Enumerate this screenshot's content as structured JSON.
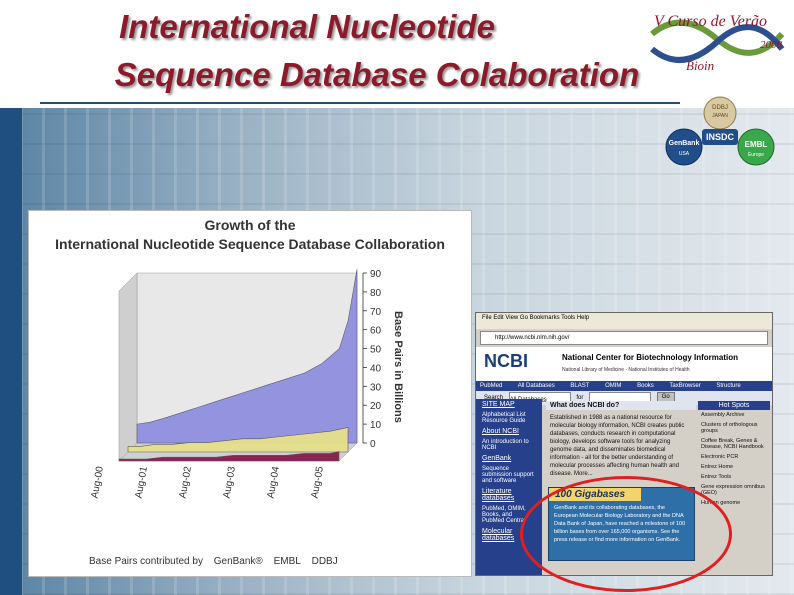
{
  "title": {
    "line1": "International Nucleotide",
    "line2": "Sequence Database Colaboration"
  },
  "logo_curso": {
    "text1": "V Curso de Verão",
    "text2": "2008",
    "text3": "Bioin"
  },
  "logo_insdc": {
    "ddbj": "DDBJ",
    "ddbj_sub": "JAPAN",
    "center": "INSDC",
    "genbank": "GenBank",
    "genbank_sub": "USA",
    "embl": "EMBL",
    "embl_sub": "Europe"
  },
  "chart_panel": {
    "title1": "Growth of the",
    "title2": "International Nucleotide Sequence Database Collaboration",
    "legend_prefix": "Base Pairs contributed by",
    "legend_items": [
      {
        "label": "GenBank®",
        "color": "#8f8fe0"
      },
      {
        "label": "EMBL",
        "color": "#e6e08a"
      },
      {
        "label": "DDBJ",
        "color": "#8a1a4a"
      }
    ]
  },
  "chart_data": {
    "type": "area",
    "title": "Growth of the International Nucleotide Sequence Database Collaboration",
    "ylabel": "Base Pairs in Billions",
    "xlabel": "",
    "x_tick_labels": [
      "Aug-00",
      "Aug-01",
      "Aug-02",
      "Aug-03",
      "Aug-04",
      "Aug-05"
    ],
    "y_ticks": [
      0,
      10,
      20,
      30,
      40,
      50,
      60,
      70,
      80,
      90
    ],
    "ylim": [
      0,
      90
    ],
    "x": [
      2000.6,
      2000.9,
      2001.2,
      2001.6,
      2002.0,
      2002.4,
      2002.8,
      2003.2,
      2003.6,
      2004.0,
      2004.4,
      2004.8,
      2005.2,
      2005.4,
      2005.6
    ],
    "series": [
      {
        "name": "GenBank",
        "color": "#8f8fe0",
        "values": [
          10,
          11,
          13,
          16,
          19,
          22,
          25,
          28,
          31,
          34,
          37,
          42,
          50,
          65,
          92
        ]
      },
      {
        "name": "EMBL",
        "color": "#e6e08a",
        "values": [
          3,
          3,
          4,
          4,
          5,
          5,
          6,
          7,
          7,
          8,
          9,
          10,
          11,
          12,
          13
        ]
      },
      {
        "name": "DDBJ",
        "color": "#8a1a4a",
        "values": [
          1,
          1,
          1,
          2,
          2,
          2,
          2,
          3,
          3,
          3,
          3,
          4,
          4,
          4,
          5
        ]
      }
    ],
    "grid": false,
    "legend": "bottom"
  },
  "ncbi_screenshot": {
    "menu": "File  Edit  View  Go  Bookmarks  Tools  Help",
    "address": "http://www.ncbi.nlm.nih.gov/",
    "logo": "NCBI",
    "center_title": "National Center for Biotechnology Information",
    "center_sub": "National Library of Medicine · National Institutes of Health",
    "nav": [
      "PubMed",
      "All Databases",
      "BLAST",
      "OMIM",
      "Books",
      "TaxBrowser",
      "Structure"
    ],
    "search_label": "Search",
    "search_select": "All Databases",
    "search_for": "for",
    "go_label": "Go",
    "sidebar": [
      {
        "head": "SITE MAP",
        "text": "Alphabetical List Resource Guide"
      },
      {
        "head": "About NCBI",
        "text": "An introduction to NCBI"
      },
      {
        "head": "GenBank",
        "text": "Sequence submission support and software"
      },
      {
        "head": "Literature databases",
        "text": "PubMed, OMIM, Books, and PubMed Central"
      },
      {
        "head": "Molecular databases",
        "text": ""
      }
    ],
    "main_heading": "What does NCBI do?",
    "main_text": "Established in 1988 as a national resource for molecular biology information, NCBI creates public databases, conducts research in computational biology, develops software tools for analyzing genome data, and disseminates biomedical information - all for the better understanding of molecular processes affecting human health and disease. More...",
    "hot_heading": "Hot Spots",
    "hot_items": [
      "Assembly Archive",
      "Clusters of orthologous groups",
      "Coffee Break, Genes & Disease, NCBI Handbook",
      "Electronic PCR",
      "Entrez Home",
      "Entrez Tools",
      "Gene expression omnibus (GEO)",
      "Human genome"
    ],
    "giga_heading": "100 Gigabases",
    "giga_text": "GenBank and its collaborating databases, the European Molecular Biology Laboratory and the DNA Data Bank of Japan, have reached a milestone of 100 billion bases from over 165,000 organisms. See the press release or find more information on GenBank."
  }
}
